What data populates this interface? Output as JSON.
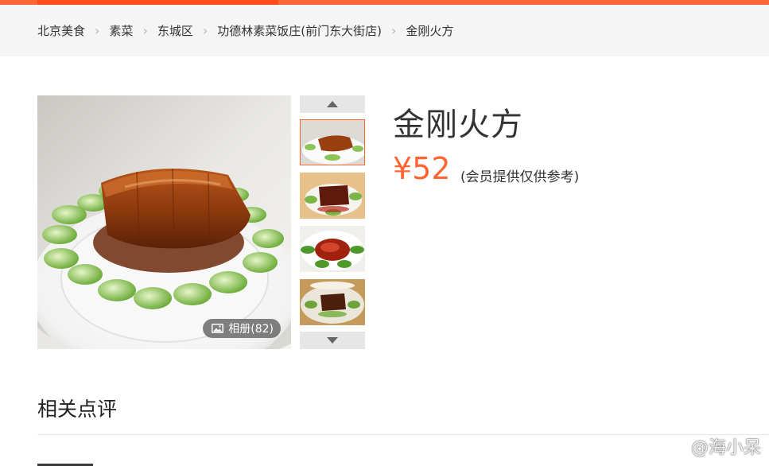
{
  "breadcrumb": {
    "items": [
      "北京美食",
      "素菜",
      "东城区",
      "功德林素菜饭庄(前门东大街店)"
    ],
    "current": "金刚火方"
  },
  "dish": {
    "name": "金刚火方",
    "price": "¥52",
    "price_note": "(会员提供仅供参考)"
  },
  "gallery": {
    "album_label": "相册(82)",
    "thumbnail_count": 4,
    "selected_index": 0
  },
  "reviews": {
    "section_title": "相关点评"
  },
  "watermark": {
    "text": "@海小呆"
  },
  "colors": {
    "accent": "#ff6633",
    "breadcrumb_bg": "#f5f5f5",
    "text": "#333333"
  },
  "icons": [
    "chevron-right-icon",
    "picture-icon",
    "arrow-up-icon",
    "arrow-down-icon",
    "weibo-icon"
  ]
}
